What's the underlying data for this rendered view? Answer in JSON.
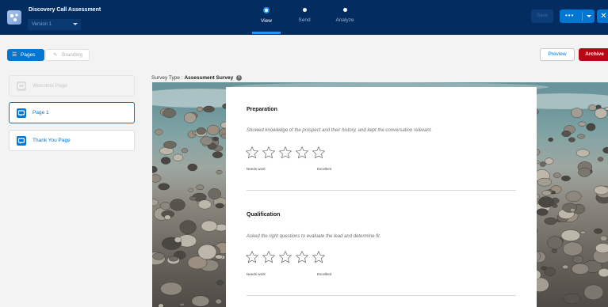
{
  "header": {
    "app_title": "Discovery Call Assessment",
    "version_label": "Version 1",
    "nav": [
      {
        "label": "View",
        "active": true
      },
      {
        "label": "Send",
        "active": false
      },
      {
        "label": "Analyze",
        "active": false
      }
    ],
    "save_label": "Save",
    "more_icon": "more-dots-icon",
    "close_icon": "close-icon",
    "colors": {
      "bar": "#032d60",
      "accent": "#1b96ff",
      "brand": "#0176d3"
    }
  },
  "toolbar": {
    "pages_label": "Pages",
    "pages_icon": "list-icon",
    "branding_label": "Branding",
    "branding_icon": "pencil-icon",
    "preview_label": "Preview",
    "archive_label": "Archive",
    "archive_color": "#ba0517"
  },
  "pages": [
    {
      "label": "Welcome Page",
      "state": "disabled"
    },
    {
      "label": "Page 1",
      "state": "selected"
    },
    {
      "label": "Thank You Page",
      "state": "normal"
    }
  ],
  "survey": {
    "type_label": "Survey Type :",
    "type_value": "Assessment Survey",
    "questions": [
      {
        "title": "Preparation",
        "description": "Showed knowledge of the prospect and their history, and kept the conversation relevant.",
        "rating_scale": 5,
        "low_label": "Needs work",
        "high_label": "Excellent"
      },
      {
        "title": "Qualification",
        "description": "Asked the right questions to evaluate the lead and determine fit.",
        "rating_scale": 5,
        "low_label": "Needs work",
        "high_label": "Excellent"
      }
    ]
  }
}
